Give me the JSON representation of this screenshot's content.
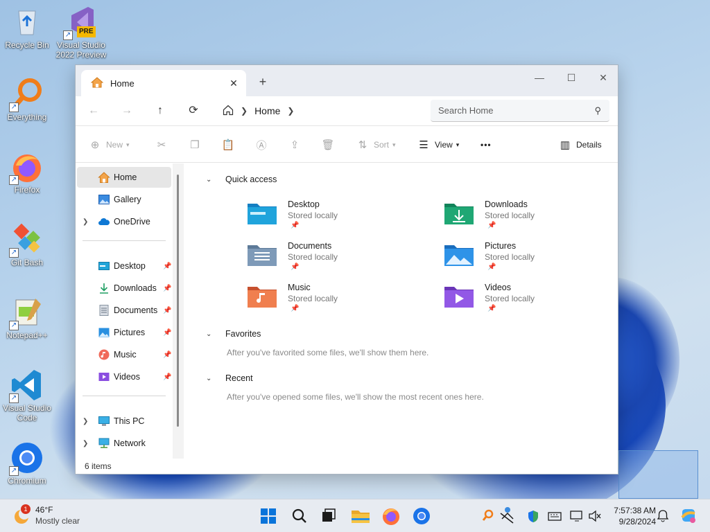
{
  "desktop": {
    "icons": [
      {
        "label": "Recycle Bin"
      },
      {
        "label": "Visual Studio 2022 Preview",
        "badge": "PRE"
      },
      {
        "label": "Everything"
      },
      {
        "label": "Firefox"
      },
      {
        "label": "Git Bash"
      },
      {
        "label": "Notepad++"
      },
      {
        "label": "Visual Studio Code"
      },
      {
        "label": "Chromium"
      }
    ]
  },
  "window": {
    "tab_label": "Home",
    "nav": {
      "back": "←",
      "forward": "→",
      "up": "↑",
      "refresh": "⟳"
    },
    "address": {
      "crumb": "Home"
    },
    "search": {
      "placeholder": "Search Home"
    },
    "toolbar": {
      "new_label": "New",
      "sort_label": "Sort",
      "view_label": "View",
      "more_label": "•••",
      "details_label": "Details"
    },
    "sidebar": {
      "items": [
        {
          "label": "Home"
        },
        {
          "label": "Gallery"
        },
        {
          "label": "OneDrive"
        },
        {
          "label": "Desktop"
        },
        {
          "label": "Downloads"
        },
        {
          "label": "Documents"
        },
        {
          "label": "Pictures"
        },
        {
          "label": "Music"
        },
        {
          "label": "Videos"
        },
        {
          "label": "This PC"
        },
        {
          "label": "Network"
        }
      ]
    },
    "content": {
      "quick_access": {
        "title": "Quick access",
        "folders": [
          {
            "name": "Desktop",
            "sub": "Stored locally"
          },
          {
            "name": "Downloads",
            "sub": "Stored locally"
          },
          {
            "name": "Documents",
            "sub": "Stored locally"
          },
          {
            "name": "Pictures",
            "sub": "Stored locally"
          },
          {
            "name": "Music",
            "sub": "Stored locally"
          },
          {
            "name": "Videos",
            "sub": "Stored locally"
          }
        ]
      },
      "favorites": {
        "title": "Favorites",
        "note": "After you've favorited some files, we'll show them here."
      },
      "recent": {
        "title": "Recent",
        "note": "After you've opened some files, we'll show the most recent ones here."
      }
    },
    "status": "6 items"
  },
  "taskbar": {
    "weather": {
      "temp": "46°F",
      "desc": "Mostly clear",
      "alert": "1"
    },
    "clock": {
      "time": "7:57:38 AM",
      "date": "9/28/2024"
    },
    "colors": {
      "accent": "#0067c0",
      "indicator": "#e0553a"
    }
  }
}
